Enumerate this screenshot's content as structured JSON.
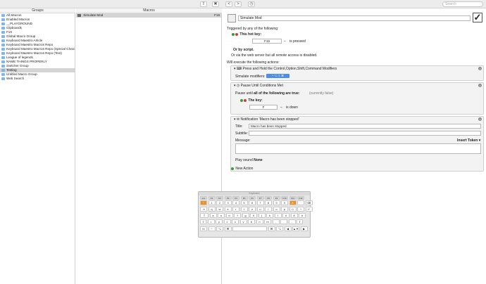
{
  "toolbar": {
    "share_label": "⇧",
    "tools_label": "✖",
    "back_label": "<",
    "forward_label": ">",
    "clock_label": "◷",
    "search_placeholder": "Search"
  },
  "columns": {
    "groups": "Groups",
    "macros": "Macros"
  },
  "groups": [
    "All Macros",
    "Enabled Macros",
    "__PLAYGROUND",
    "Clipboards",
    "F19",
    "Global Macro Group",
    "Keyboard Maestro Article",
    "Keyboard Maestro Macros Repo",
    "Keyboard Maestro Macros Repo (Special Charact...",
    "Keyboard Maestro Macros Repo (Text)",
    "League of legends",
    "NAME THINGS PROPERLY",
    "Switcher Group",
    "Testing",
    "Untitled Macro Group",
    "Web Search"
  ],
  "selected_group_index": 13,
  "macros": [
    {
      "name": "Simulate Mod",
      "hotkey": "F19"
    }
  ],
  "editor": {
    "macro_name": "Simulate Mod",
    "enabled_mark": "✓",
    "triggered_label": "Triggered by any of the following:",
    "hotkey_trigger_label": "This hot key:",
    "hotkey_value": "F19",
    "hotkey_dash": "–",
    "pressed_label": "is pressed",
    "or_by_script": "Or by script.",
    "or_web": "Or via the web server but all remote access is disabled.",
    "will_execute": "Will execute the following actions:",
    "action1": {
      "title": "Press and Hold the Control,Option,Shift,Command Modifiers",
      "modifiers_label": "Simulate modifiers:",
      "modifiers_value": "^ ⌥ ⇧ ⌘"
    },
    "action2": {
      "title": "Pause Until Conditions Met",
      "pause_until": "Pause until",
      "all_true": "all of the following are true:",
      "currently": "(currently false)",
      "key_label": "The key:",
      "key_value": "F",
      "key_dash": "–",
      "is_down": "is down"
    },
    "action3": {
      "title": "Notification 'Macro has been stopped'",
      "title_label": "Title:",
      "title_value": "Macro has been stopped",
      "subtitle_label": "Subtitle:",
      "subtitle_value": "",
      "message_label": "Message:",
      "insert_token": "Insert Token ▾",
      "message_value": "",
      "play_sound_label": "Play sound",
      "sound_value": "None"
    },
    "new_action": "New Action"
  },
  "keyboard": {
    "title": "Keyboard",
    "fn_row": [
      "esc",
      "F1",
      "F2",
      "F3",
      "F4",
      "F5",
      "F6",
      "F7",
      "F8",
      "F9",
      "F10",
      "F11",
      "F12"
    ],
    "row1": [
      "^",
      "1",
      "2",
      "3",
      "4",
      "5",
      "6",
      "7",
      "8",
      "9",
      "0",
      "ß",
      "´",
      "⌫"
    ],
    "row2": [
      "⇥",
      "q",
      "w",
      "e",
      "r",
      "t",
      "z",
      "u",
      "i",
      "o",
      "p",
      "ü",
      "+",
      "↵"
    ],
    "row3": [
      "⇪",
      "a",
      "s",
      "d",
      "f",
      "g",
      "h",
      "j",
      "k",
      "l",
      "ö",
      "ä",
      "#"
    ],
    "row4": [
      "⇧",
      "<",
      "y",
      "x",
      "c",
      "v",
      "b",
      "n",
      "m",
      ",",
      ".",
      "-",
      "⇧"
    ],
    "row5": [
      "fn",
      "^",
      "⌥",
      "⌘",
      "",
      "⌘",
      "⌥",
      "◀",
      "▲▼",
      "▶"
    ]
  }
}
